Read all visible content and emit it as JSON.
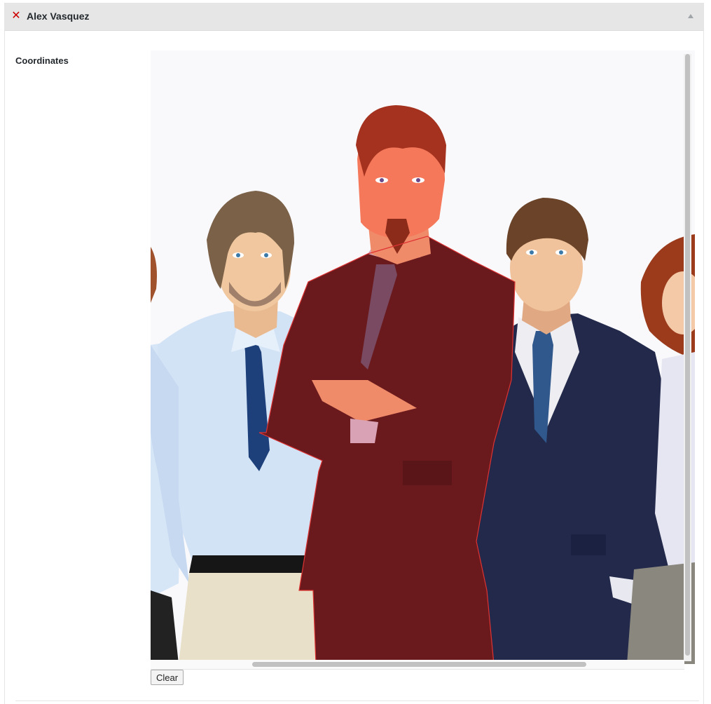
{
  "panel": {
    "title": "Alex Vasquez",
    "remove_icon": "close-icon",
    "collapse_icon": "triangle-up-icon"
  },
  "field": {
    "label": "Coordinates"
  },
  "image": {
    "description_icon": "people-illustration",
    "highlight_color": "#c0392b"
  },
  "actions": {
    "clear_label": "Clear"
  }
}
